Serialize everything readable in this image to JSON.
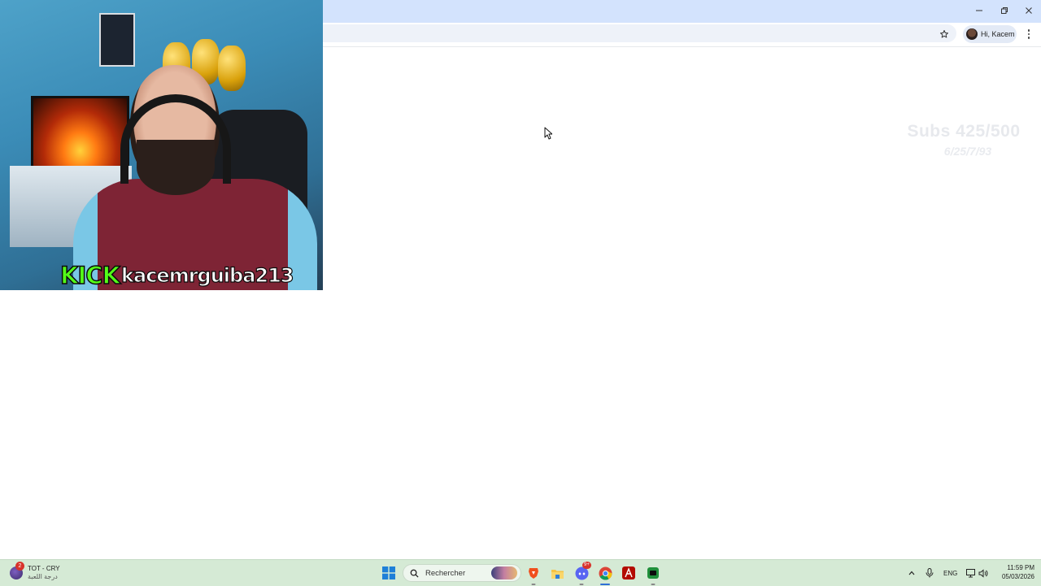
{
  "browser": {
    "profile_label": "Hi, Kacem",
    "window_controls": {
      "minimize": "minimize-icon",
      "restore": "restore-icon",
      "close": "close-icon"
    },
    "bookmark_icon": "star-icon",
    "menu_icon": "more-vert-icon"
  },
  "overlay": {
    "webcam_brand": "KICK",
    "webcam_username": "kacemrguiba213",
    "sub_goal": "Subs 425/500",
    "sub_goal_sub": "6/25/7/93"
  },
  "taskbar": {
    "game_badge_count": "2",
    "game_title": "TOT - CRY",
    "game_subtitle": "درجة اللعبة",
    "search_placeholder": "Rechercher",
    "apps": [
      "windows-start-icon",
      "brave-icon",
      "file-explorer-icon",
      "discord-icon",
      "chrome-icon",
      "acrobat-icon",
      "kick-app-icon"
    ],
    "discord_badge": "9+",
    "language": "ENG",
    "time": "11:59 PM",
    "date": "05/03/2026"
  },
  "colors": {
    "titlebar": "#d3e3fd",
    "taskbar": "#d5ead5",
    "kick_green": "#53fc18"
  }
}
